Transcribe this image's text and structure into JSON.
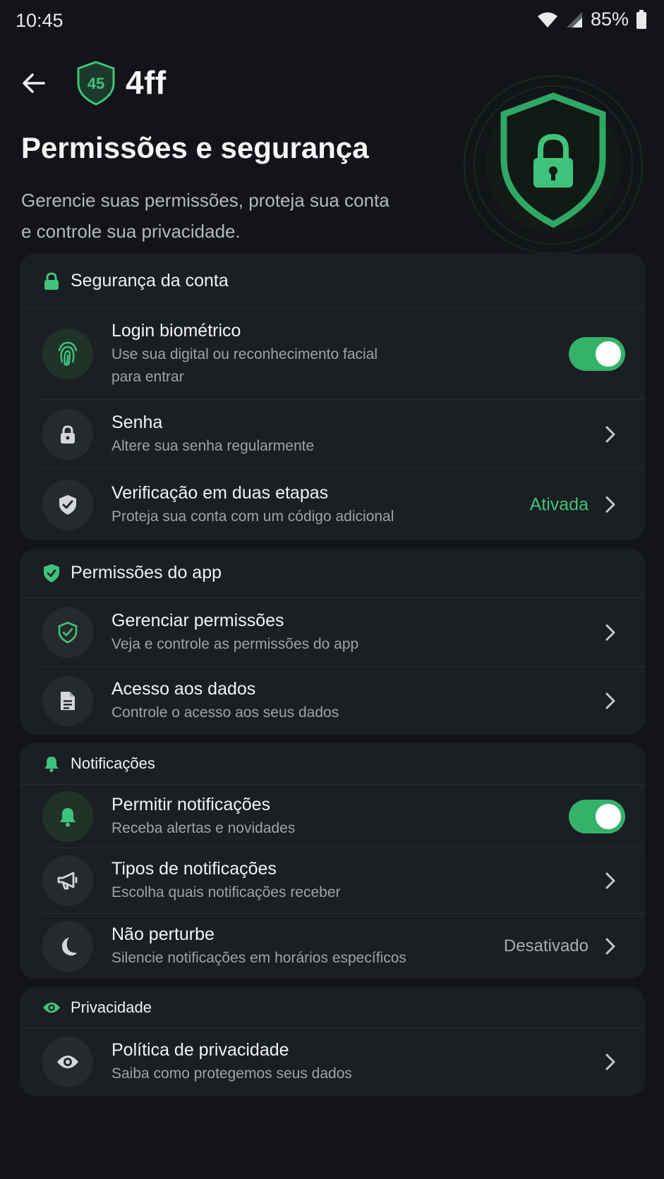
{
  "status_bar": {
    "time": "10:45",
    "battery": "85%"
  },
  "header": {
    "logo_badge": "45",
    "brand": "4ff",
    "title": "Permissões e segurança",
    "subtitle_line1": "Gerencie suas permissões, proteja sua conta",
    "subtitle_line2": "e controle sua privacidade."
  },
  "colors": {
    "accent": "#3fc37a",
    "background": "#121417",
    "card": "#1b1e22"
  },
  "sections": {
    "account_security": {
      "title": "Segurança da conta",
      "icon": "lock-icon",
      "biometric": {
        "title": "Login biométrico",
        "sub1": "Use sua digital ou reconhecimento facial",
        "sub2": "para entrar",
        "icon": "fingerprint-icon",
        "enabled": true
      },
      "password": {
        "title": "Senha",
        "sub": "Altere sua senha regularmente",
        "icon": "lock-icon"
      },
      "two_step": {
        "title": "Verificação em duas etapas",
        "sub": "Proteja sua conta com um código adicional",
        "status": "Ativada",
        "icon": "shield-check-icon"
      }
    },
    "app_permissions": {
      "title": "Permissões do app",
      "icon": "shield-check-icon",
      "manage": {
        "title": "Gerenciar permissões",
        "sub": "Veja e controle as permissões do app",
        "icon": "shield-outline-icon"
      },
      "data_access": {
        "title": "Acesso aos dados",
        "sub": "Controle o acesso aos seus dados",
        "icon": "document-icon"
      }
    },
    "notifications": {
      "title": "Notificações",
      "icon": "bell-icon",
      "allow": {
        "title": "Permitir notificações",
        "sub": "Receba alertas e novidades",
        "icon": "bell-icon",
        "enabled": true
      },
      "types": {
        "title": "Tipos de notificações",
        "sub": "Escolha quais notificações receber",
        "icon": "megaphone-icon"
      },
      "dnd": {
        "title": "Não perturbe",
        "sub": "Silencie notificações em horários específicos",
        "status": "Desativado",
        "icon": "moon-icon"
      }
    },
    "privacy": {
      "title": "Privacidade",
      "icon": "eye-icon",
      "policy": {
        "title": "Política de privacidade",
        "sub": "Saiba como protegemos seus dados",
        "icon": "eye-icon"
      }
    }
  }
}
